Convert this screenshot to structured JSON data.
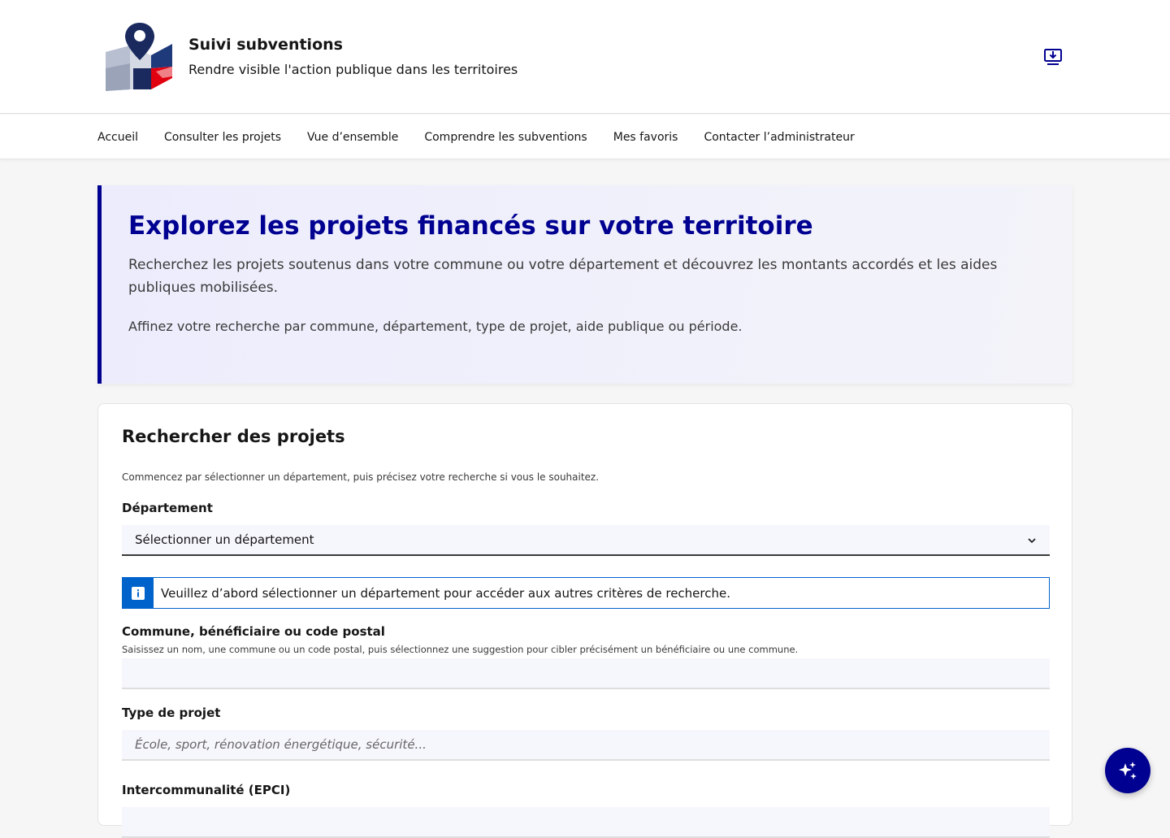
{
  "header": {
    "logo_icon": "map-pin-logo-icon",
    "title": "Suivi subventions",
    "tagline": "Rendre visible l'action publique dans les territoires",
    "install_icon": "download-install-icon"
  },
  "nav": {
    "items": [
      {
        "label": "Accueil"
      },
      {
        "label": "Consulter les projets"
      },
      {
        "label": "Vue d’ensemble"
      },
      {
        "label": "Comprendre les subventions"
      },
      {
        "label": "Mes favoris"
      },
      {
        "label": "Contacter l’administrateur"
      }
    ]
  },
  "hero": {
    "title": "Explorez les projets financés sur votre territoire",
    "description": "Recherchez les projets soutenus dans votre commune ou votre département et découvrez les montants accordés et les aides publiques mobilisées.",
    "hint": "Affinez votre recherche par commune, département, type de projet, aide publique ou période."
  },
  "search": {
    "title": "Rechercher des projets",
    "intro": "Commencez par sélectionner un département, puis précisez votre recherche si vous le souhaitez.",
    "departement": {
      "label": "Département",
      "selected": "Sélectionner un département"
    },
    "info": "Veuillez d’abord sélectionner un département pour accéder aux autres critères de recherche.",
    "commune": {
      "label": "Commune, bénéficiaire ou code postal",
      "hint": "Saisissez un nom, une commune ou un code postal, puis sélectionnez une suggestion pour cibler précisément un bénéficiaire ou une commune.",
      "value": ""
    },
    "type_projet": {
      "label": "Type de projet",
      "placeholder": "École, sport, rénovation énergétique, sécurité..."
    },
    "epci": {
      "label": "Intercommunalité (EPCI)"
    }
  },
  "colors": {
    "primary": "#000091",
    "info": "#0063cb",
    "hero_bg": "#ececfd",
    "accent_red": "#e1000f"
  },
  "fab": {
    "icon": "sparkles-ai-icon"
  }
}
